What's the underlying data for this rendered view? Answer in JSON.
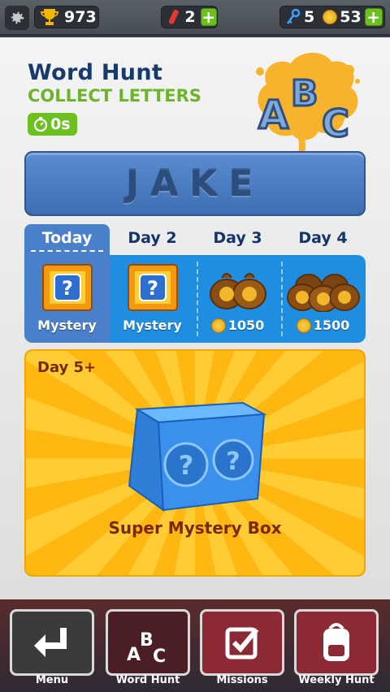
{
  "topbar": {
    "trophies": "973",
    "boards": "2",
    "keys": "5",
    "coins": "53"
  },
  "event": {
    "title": "Word Hunt",
    "subtitle": "COLLECT LETTERS",
    "timer": "0s",
    "logo_letters": [
      "A",
      "B",
      "C"
    ],
    "word": "JAKE"
  },
  "days": [
    {
      "label": "Today",
      "reward": "Mystery",
      "icon": "mystery-box-icon"
    },
    {
      "label": "Day 2",
      "reward": "Mystery",
      "icon": "mystery-box-icon"
    },
    {
      "label": "Day 3",
      "reward": "1050",
      "icon": "coin-bags-icon"
    },
    {
      "label": "Day 4",
      "reward": "1500",
      "icon": "coin-bags-icon"
    }
  ],
  "super": {
    "label": "Day 5+",
    "reward": "Super Mystery Box"
  },
  "nav": [
    {
      "label": "Menu",
      "icon": "return-arrow-icon"
    },
    {
      "label": "Word Hunt",
      "icon": "abc-icon"
    },
    {
      "label": "Missions",
      "icon": "checkbox-icon"
    },
    {
      "label": "Weekly Hunt",
      "icon": "backpack-icon"
    }
  ],
  "colors": {
    "title": "#163a6b",
    "subtitle": "#6cb52a",
    "day_strip": "#1f8de0",
    "today": "#4a7fc9",
    "super_bg": "#ffcc33"
  }
}
